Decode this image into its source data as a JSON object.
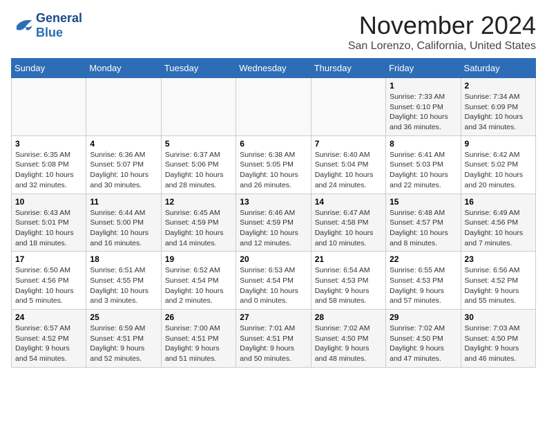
{
  "header": {
    "logo_line1": "General",
    "logo_line2": "Blue",
    "month": "November 2024",
    "location": "San Lorenzo, California, United States"
  },
  "weekdays": [
    "Sunday",
    "Monday",
    "Tuesday",
    "Wednesday",
    "Thursday",
    "Friday",
    "Saturday"
  ],
  "weeks": [
    [
      {
        "day": "",
        "info": ""
      },
      {
        "day": "",
        "info": ""
      },
      {
        "day": "",
        "info": ""
      },
      {
        "day": "",
        "info": ""
      },
      {
        "day": "",
        "info": ""
      },
      {
        "day": "1",
        "info": "Sunrise: 7:33 AM\nSunset: 6:10 PM\nDaylight: 10 hours\nand 36 minutes."
      },
      {
        "day": "2",
        "info": "Sunrise: 7:34 AM\nSunset: 6:09 PM\nDaylight: 10 hours\nand 34 minutes."
      }
    ],
    [
      {
        "day": "3",
        "info": "Sunrise: 6:35 AM\nSunset: 5:08 PM\nDaylight: 10 hours\nand 32 minutes."
      },
      {
        "day": "4",
        "info": "Sunrise: 6:36 AM\nSunset: 5:07 PM\nDaylight: 10 hours\nand 30 minutes."
      },
      {
        "day": "5",
        "info": "Sunrise: 6:37 AM\nSunset: 5:06 PM\nDaylight: 10 hours\nand 28 minutes."
      },
      {
        "day": "6",
        "info": "Sunrise: 6:38 AM\nSunset: 5:05 PM\nDaylight: 10 hours\nand 26 minutes."
      },
      {
        "day": "7",
        "info": "Sunrise: 6:40 AM\nSunset: 5:04 PM\nDaylight: 10 hours\nand 24 minutes."
      },
      {
        "day": "8",
        "info": "Sunrise: 6:41 AM\nSunset: 5:03 PM\nDaylight: 10 hours\nand 22 minutes."
      },
      {
        "day": "9",
        "info": "Sunrise: 6:42 AM\nSunset: 5:02 PM\nDaylight: 10 hours\nand 20 minutes."
      }
    ],
    [
      {
        "day": "10",
        "info": "Sunrise: 6:43 AM\nSunset: 5:01 PM\nDaylight: 10 hours\nand 18 minutes."
      },
      {
        "day": "11",
        "info": "Sunrise: 6:44 AM\nSunset: 5:00 PM\nDaylight: 10 hours\nand 16 minutes."
      },
      {
        "day": "12",
        "info": "Sunrise: 6:45 AM\nSunset: 4:59 PM\nDaylight: 10 hours\nand 14 minutes."
      },
      {
        "day": "13",
        "info": "Sunrise: 6:46 AM\nSunset: 4:59 PM\nDaylight: 10 hours\nand 12 minutes."
      },
      {
        "day": "14",
        "info": "Sunrise: 6:47 AM\nSunset: 4:58 PM\nDaylight: 10 hours\nand 10 minutes."
      },
      {
        "day": "15",
        "info": "Sunrise: 6:48 AM\nSunset: 4:57 PM\nDaylight: 10 hours\nand 8 minutes."
      },
      {
        "day": "16",
        "info": "Sunrise: 6:49 AM\nSunset: 4:56 PM\nDaylight: 10 hours\nand 7 minutes."
      }
    ],
    [
      {
        "day": "17",
        "info": "Sunrise: 6:50 AM\nSunset: 4:56 PM\nDaylight: 10 hours\nand 5 minutes."
      },
      {
        "day": "18",
        "info": "Sunrise: 6:51 AM\nSunset: 4:55 PM\nDaylight: 10 hours\nand 3 minutes."
      },
      {
        "day": "19",
        "info": "Sunrise: 6:52 AM\nSunset: 4:54 PM\nDaylight: 10 hours\nand 2 minutes."
      },
      {
        "day": "20",
        "info": "Sunrise: 6:53 AM\nSunset: 4:54 PM\nDaylight: 10 hours\nand 0 minutes."
      },
      {
        "day": "21",
        "info": "Sunrise: 6:54 AM\nSunset: 4:53 PM\nDaylight: 9 hours\nand 58 minutes."
      },
      {
        "day": "22",
        "info": "Sunrise: 6:55 AM\nSunset: 4:53 PM\nDaylight: 9 hours\nand 57 minutes."
      },
      {
        "day": "23",
        "info": "Sunrise: 6:56 AM\nSunset: 4:52 PM\nDaylight: 9 hours\nand 55 minutes."
      }
    ],
    [
      {
        "day": "24",
        "info": "Sunrise: 6:57 AM\nSunset: 4:52 PM\nDaylight: 9 hours\nand 54 minutes."
      },
      {
        "day": "25",
        "info": "Sunrise: 6:59 AM\nSunset: 4:51 PM\nDaylight: 9 hours\nand 52 minutes."
      },
      {
        "day": "26",
        "info": "Sunrise: 7:00 AM\nSunset: 4:51 PM\nDaylight: 9 hours\nand 51 minutes."
      },
      {
        "day": "27",
        "info": "Sunrise: 7:01 AM\nSunset: 4:51 PM\nDaylight: 9 hours\nand 50 minutes."
      },
      {
        "day": "28",
        "info": "Sunrise: 7:02 AM\nSunset: 4:50 PM\nDaylight: 9 hours\nand 48 minutes."
      },
      {
        "day": "29",
        "info": "Sunrise: 7:02 AM\nSunset: 4:50 PM\nDaylight: 9 hours\nand 47 minutes."
      },
      {
        "day": "30",
        "info": "Sunrise: 7:03 AM\nSunset: 4:50 PM\nDaylight: 9 hours\nand 46 minutes."
      }
    ]
  ]
}
